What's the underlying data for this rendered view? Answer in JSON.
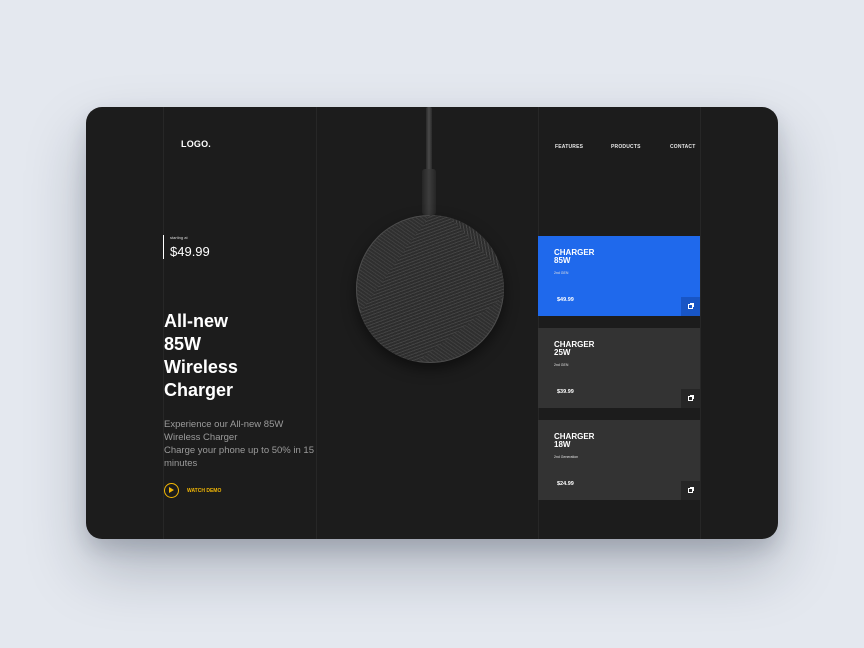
{
  "header": {
    "logo": "LOGO.",
    "nav": [
      "FEATURES",
      "PRODUCTS",
      "CONTACT"
    ]
  },
  "hero": {
    "price_caption": "starting at",
    "price": "$49.99",
    "headline": [
      "All-new",
      "85W",
      "Wireless",
      "Charger"
    ],
    "description": [
      "Experience our All-new 85W",
      "Wireless Charger",
      "Charge your phone up to 50% in 15",
      "minutes"
    ],
    "watch_demo": "WATCH DEMO",
    "watch_icon": "play-circle-icon"
  },
  "products": [
    {
      "title": [
        "CHARGER",
        "85W"
      ],
      "subtitle": "2nd GEN",
      "price": "$49.99",
      "active": true
    },
    {
      "title": [
        "CHARGER",
        "25W"
      ],
      "subtitle": "2nd GEN",
      "price": "$39.99",
      "active": false
    },
    {
      "title": [
        "CHARGER",
        "18W"
      ],
      "subtitle": "2nd Generation",
      "price": "$24.99",
      "active": false
    }
  ],
  "colors": {
    "background": "#1c1c1c",
    "card": "#333333",
    "card_active": "#1f69ec",
    "accent": "#f2b705",
    "page": "#e4e8ef"
  }
}
